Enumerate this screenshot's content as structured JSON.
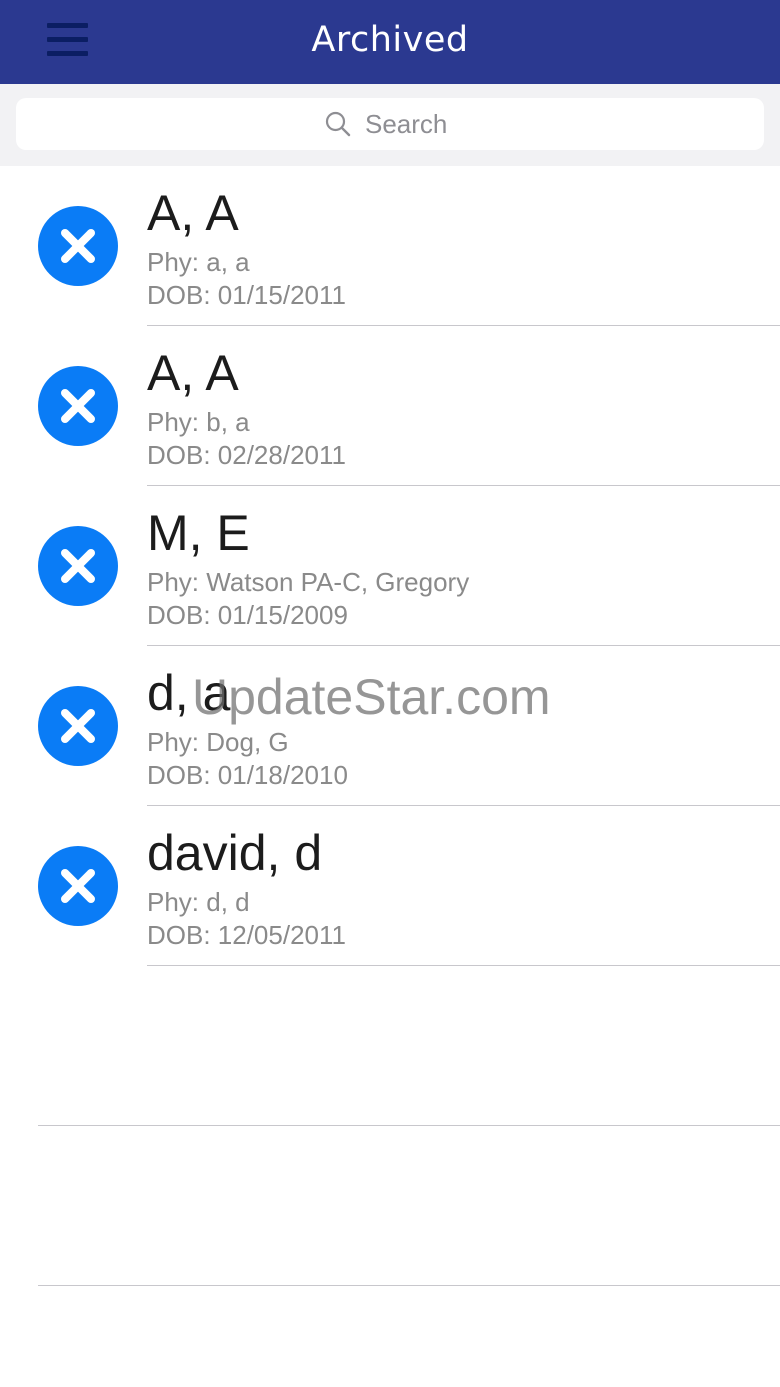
{
  "header": {
    "title": "Archived",
    "menu_icon": "hamburger-menu-icon",
    "background_color": "#2b3990"
  },
  "search": {
    "placeholder": "Search",
    "value": "",
    "icon": "search-icon"
  },
  "patients": [
    {
      "name": "A, A",
      "phy": "Phy: a, a",
      "dob": "DOB: 01/15/2011"
    },
    {
      "name": "A, A",
      "phy": "Phy: b, a",
      "dob": "DOB: 02/28/2011"
    },
    {
      "name": "M, E",
      "phy": "Phy: Watson PA-C, Gregory",
      "dob": "DOB: 01/15/2009"
    },
    {
      "name": "d, a",
      "phy": "Phy: Dog, G",
      "dob": "DOB: 01/18/2010"
    },
    {
      "name": "david, d",
      "phy": "Phy: d, d",
      "dob": "DOB: 12/05/2011"
    }
  ],
  "row_action_icon": "remove-circle-icon",
  "accent_color": "#0a7cf6",
  "watermark": "UpdateStar.com"
}
